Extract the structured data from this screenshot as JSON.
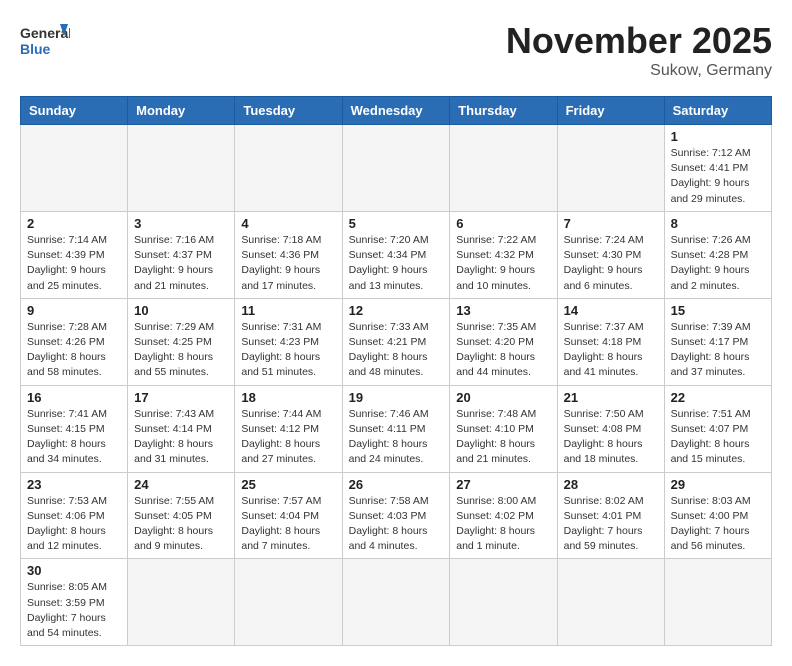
{
  "header": {
    "logo_general": "General",
    "logo_blue": "Blue",
    "month_year": "November 2025",
    "location": "Sukow, Germany"
  },
  "weekdays": [
    "Sunday",
    "Monday",
    "Tuesday",
    "Wednesday",
    "Thursday",
    "Friday",
    "Saturday"
  ],
  "days": {
    "d1": {
      "n": "1",
      "sunrise": "7:12 AM",
      "sunset": "4:41 PM",
      "daylight": "9 hours and 29 minutes."
    },
    "d2": {
      "n": "2",
      "sunrise": "7:14 AM",
      "sunset": "4:39 PM",
      "daylight": "9 hours and 25 minutes."
    },
    "d3": {
      "n": "3",
      "sunrise": "7:16 AM",
      "sunset": "4:37 PM",
      "daylight": "9 hours and 21 minutes."
    },
    "d4": {
      "n": "4",
      "sunrise": "7:18 AM",
      "sunset": "4:36 PM",
      "daylight": "9 hours and 17 minutes."
    },
    "d5": {
      "n": "5",
      "sunrise": "7:20 AM",
      "sunset": "4:34 PM",
      "daylight": "9 hours and 13 minutes."
    },
    "d6": {
      "n": "6",
      "sunrise": "7:22 AM",
      "sunset": "4:32 PM",
      "daylight": "9 hours and 10 minutes."
    },
    "d7": {
      "n": "7",
      "sunrise": "7:24 AM",
      "sunset": "4:30 PM",
      "daylight": "9 hours and 6 minutes."
    },
    "d8": {
      "n": "8",
      "sunrise": "7:26 AM",
      "sunset": "4:28 PM",
      "daylight": "9 hours and 2 minutes."
    },
    "d9": {
      "n": "9",
      "sunrise": "7:28 AM",
      "sunset": "4:26 PM",
      "daylight": "8 hours and 58 minutes."
    },
    "d10": {
      "n": "10",
      "sunrise": "7:29 AM",
      "sunset": "4:25 PM",
      "daylight": "8 hours and 55 minutes."
    },
    "d11": {
      "n": "11",
      "sunrise": "7:31 AM",
      "sunset": "4:23 PM",
      "daylight": "8 hours and 51 minutes."
    },
    "d12": {
      "n": "12",
      "sunrise": "7:33 AM",
      "sunset": "4:21 PM",
      "daylight": "8 hours and 48 minutes."
    },
    "d13": {
      "n": "13",
      "sunrise": "7:35 AM",
      "sunset": "4:20 PM",
      "daylight": "8 hours and 44 minutes."
    },
    "d14": {
      "n": "14",
      "sunrise": "7:37 AM",
      "sunset": "4:18 PM",
      "daylight": "8 hours and 41 minutes."
    },
    "d15": {
      "n": "15",
      "sunrise": "7:39 AM",
      "sunset": "4:17 PM",
      "daylight": "8 hours and 37 minutes."
    },
    "d16": {
      "n": "16",
      "sunrise": "7:41 AM",
      "sunset": "4:15 PM",
      "daylight": "8 hours and 34 minutes."
    },
    "d17": {
      "n": "17",
      "sunrise": "7:43 AM",
      "sunset": "4:14 PM",
      "daylight": "8 hours and 31 minutes."
    },
    "d18": {
      "n": "18",
      "sunrise": "7:44 AM",
      "sunset": "4:12 PM",
      "daylight": "8 hours and 27 minutes."
    },
    "d19": {
      "n": "19",
      "sunrise": "7:46 AM",
      "sunset": "4:11 PM",
      "daylight": "8 hours and 24 minutes."
    },
    "d20": {
      "n": "20",
      "sunrise": "7:48 AM",
      "sunset": "4:10 PM",
      "daylight": "8 hours and 21 minutes."
    },
    "d21": {
      "n": "21",
      "sunrise": "7:50 AM",
      "sunset": "4:08 PM",
      "daylight": "8 hours and 18 minutes."
    },
    "d22": {
      "n": "22",
      "sunrise": "7:51 AM",
      "sunset": "4:07 PM",
      "daylight": "8 hours and 15 minutes."
    },
    "d23": {
      "n": "23",
      "sunrise": "7:53 AM",
      "sunset": "4:06 PM",
      "daylight": "8 hours and 12 minutes."
    },
    "d24": {
      "n": "24",
      "sunrise": "7:55 AM",
      "sunset": "4:05 PM",
      "daylight": "8 hours and 9 minutes."
    },
    "d25": {
      "n": "25",
      "sunrise": "7:57 AM",
      "sunset": "4:04 PM",
      "daylight": "8 hours and 7 minutes."
    },
    "d26": {
      "n": "26",
      "sunrise": "7:58 AM",
      "sunset": "4:03 PM",
      "daylight": "8 hours and 4 minutes."
    },
    "d27": {
      "n": "27",
      "sunrise": "8:00 AM",
      "sunset": "4:02 PM",
      "daylight": "8 hours and 1 minute."
    },
    "d28": {
      "n": "28",
      "sunrise": "8:02 AM",
      "sunset": "4:01 PM",
      "daylight": "7 hours and 59 minutes."
    },
    "d29": {
      "n": "29",
      "sunrise": "8:03 AM",
      "sunset": "4:00 PM",
      "daylight": "7 hours and 56 minutes."
    },
    "d30": {
      "n": "30",
      "sunrise": "8:05 AM",
      "sunset": "3:59 PM",
      "daylight": "7 hours and 54 minutes."
    }
  }
}
